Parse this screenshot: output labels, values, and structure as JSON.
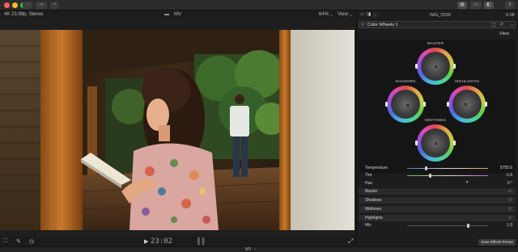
{
  "titlebar": {
    "close_color": "#ff5f57",
    "min_color": "#febc2e",
    "max_color": "#28c840"
  },
  "viewer": {
    "format": "4K 23.98p, Stereo",
    "clip_name": "MV",
    "zoom": "64%",
    "view_label": "View",
    "timecode": "23:02"
  },
  "inspector": {
    "clip_id": "IMG_0339",
    "duration": "6:08",
    "effect_name": "Color Wheels 1",
    "view_label": "View",
    "wheels": {
      "master": "MASTER",
      "shadows": "SHADOWS",
      "highlights": "HIGHLIGHTS",
      "midtones": "MIDTONES"
    },
    "params": {
      "temperature_label": "Temperature",
      "temperature_value": "5755.6",
      "tint_label": "Tint",
      "tint_value": "-1.6",
      "hue_label": "Hue",
      "hue_value": "0 °",
      "mix_label": "Mix",
      "mix_value": "1.0"
    },
    "sections": [
      "Master",
      "Shadows",
      "Midtones",
      "Highlights"
    ],
    "save_button": "Save Effects Preset"
  },
  "bottom": {
    "project_name": "MV"
  }
}
